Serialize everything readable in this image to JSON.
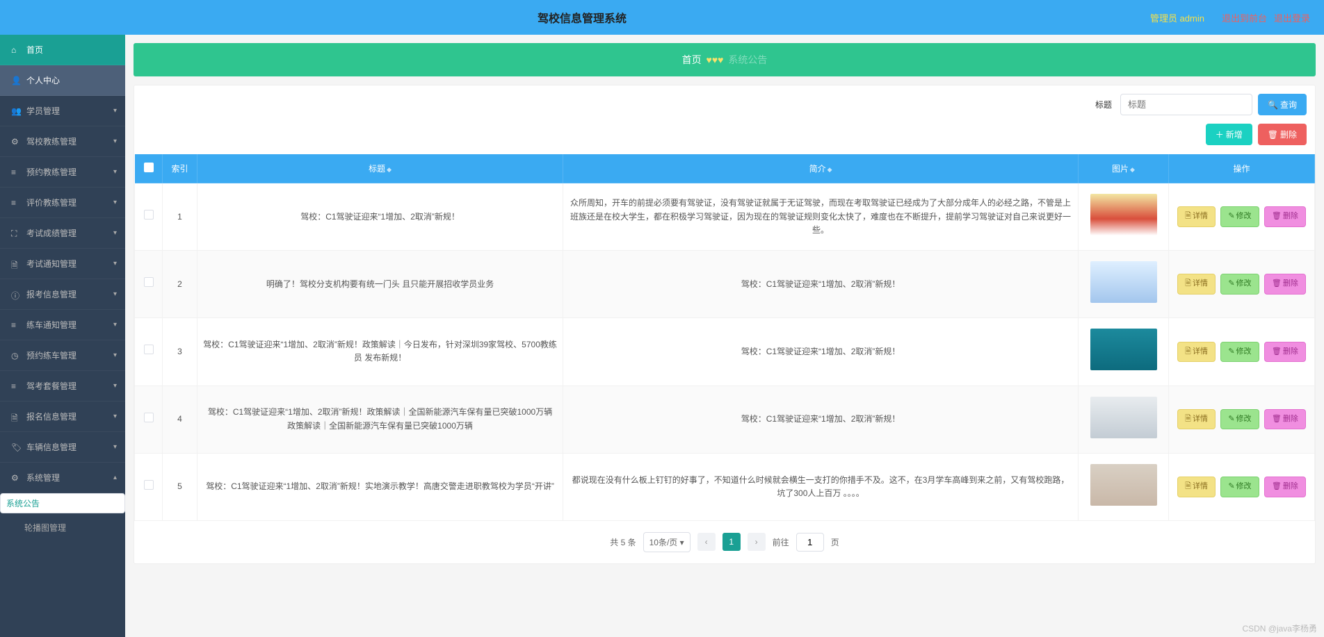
{
  "app": {
    "title": "驾校信息管理系统",
    "user_label": "管理员 admin",
    "exit_front": "退出到前台",
    "exit_login": "退出登录"
  },
  "breadcrumb": {
    "home": "首页",
    "current": "系统公告"
  },
  "sidebar": {
    "items": [
      {
        "label": "首页"
      },
      {
        "label": "个人中心"
      },
      {
        "label": "学员管理"
      },
      {
        "label": "驾校教练管理"
      },
      {
        "label": "预约教练管理"
      },
      {
        "label": "评价教练管理"
      },
      {
        "label": "考试成绩管理"
      },
      {
        "label": "考试通知管理"
      },
      {
        "label": "报考信息管理"
      },
      {
        "label": "练车通知管理"
      },
      {
        "label": "预约练车管理"
      },
      {
        "label": "驾考套餐管理"
      },
      {
        "label": "报名信息管理"
      },
      {
        "label": "车辆信息管理"
      },
      {
        "label": "系统管理"
      }
    ],
    "subitems": [
      {
        "label": "系统公告"
      },
      {
        "label": "轮播图管理"
      }
    ]
  },
  "search": {
    "label": "标题",
    "placeholder": "标题",
    "query_btn": "查询"
  },
  "toolbar": {
    "add": "新增",
    "del": "删除"
  },
  "table": {
    "cols": {
      "index": "索引",
      "title": "标题",
      "intro": "简介",
      "image": "图片",
      "ops": "操作"
    },
    "ops": {
      "detail": "详情",
      "edit": "修改",
      "del": "删除"
    },
    "rows": [
      {
        "idx": "1",
        "title": "驾校：C1驾驶证迎来“1增加、2取消”新规！",
        "intro": "众所周知，开车的前提必须要有驾驶证，没有驾驶证就属于无证驾驶，而现在考取驾驶证已经成为了大部分成年人的必经之路，不管是上班族还是在校大学生，都在积极学习驾驶证，因为现在的驾驶证规则变化太快了，难度也在不断提升，提前学习驾驶证对自己来说更好一些。"
      },
      {
        "idx": "2",
        "title": "明确了！驾校分支机构要有统一门头 且只能开展招收学员业务",
        "intro": "驾校：C1驾驶证迎来“1增加、2取消”新规！"
      },
      {
        "idx": "3",
        "title": "驾校：C1驾驶证迎来“1增加、2取消”新规！政策解读｜今日发布，针对深圳39家驾校、5700教练员 发布新规！",
        "intro": "驾校：C1驾驶证迎来“1增加、2取消”新规！"
      },
      {
        "idx": "4",
        "title": "驾校：C1驾驶证迎来“1增加、2取消”新规！政策解读｜全国新能源汽车保有量已突破1000万辆 政策解读｜全国新能源汽车保有量已突破1000万辆",
        "intro": "驾校：C1驾驶证迎来“1增加、2取消”新规！"
      },
      {
        "idx": "5",
        "title": "驾校：C1驾驶证迎来“1增加、2取消”新规！实地演示教学！高唐交警走进职教驾校为学员“开讲”",
        "intro": "都说现在没有什么板上钉钉的好事了，不知道什么时候就会横生一支打的你措手不及。这不，在3月学车高峰到来之前，又有驾校跑路，坑了300人上百万 。。。。"
      }
    ]
  },
  "pager": {
    "total": "共 5 条",
    "size": "10条/页",
    "page": "1",
    "goto": "前往",
    "goto_val": "1",
    "unit": "页"
  },
  "watermark": "CSDN @java李杨勇"
}
